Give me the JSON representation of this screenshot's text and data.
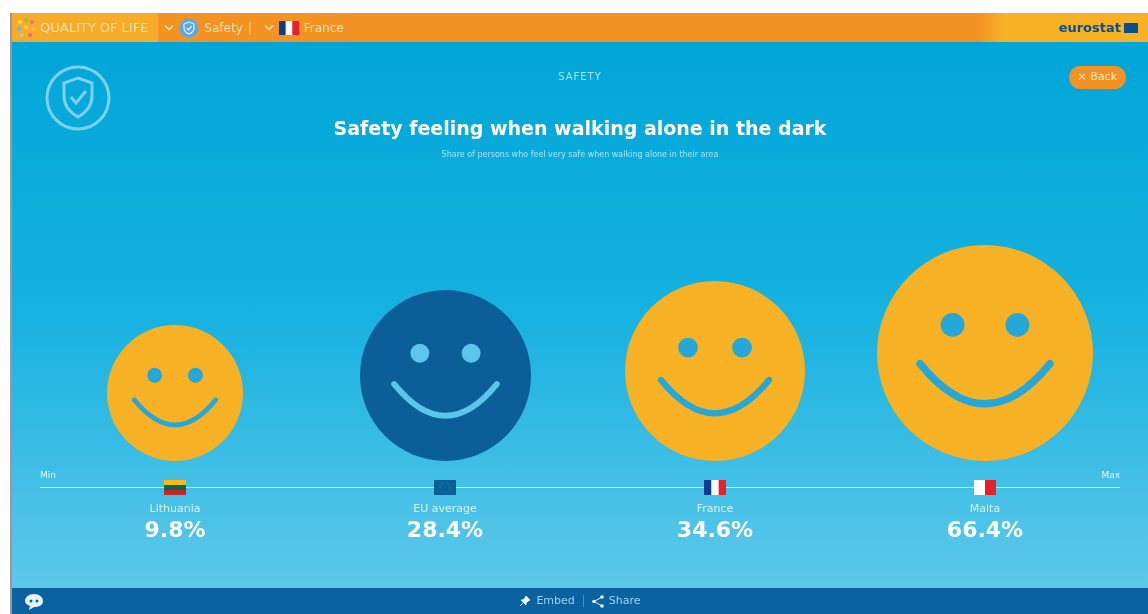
{
  "header": {
    "app_title": "QUALITY OF LIFE",
    "breadcrumbs": [
      {
        "label": "Safety",
        "separator": "|"
      },
      {
        "label": "France"
      }
    ],
    "brand": "eurostat"
  },
  "panel": {
    "caption": "SAFETY",
    "back_button": "× Back",
    "title": "Safety feeling when walking alone in the dark",
    "subtitle": "Share of persons who feel very safe when walking alone in their area"
  },
  "scale": {
    "min_label": "Min",
    "max_label": "Max"
  },
  "items": [
    {
      "name": "Lithuania",
      "value": "9.8%",
      "color": "#f7b124"
    },
    {
      "name": "EU average",
      "value": "28.4%",
      "color": "#0b5e98"
    },
    {
      "name": "France",
      "value": "34.6%",
      "color": "#f7b124"
    },
    {
      "name": "Malta",
      "value": "66.4%",
      "color": "#f7b124"
    }
  ],
  "footer": {
    "links": [
      "Embed",
      "Share"
    ]
  }
}
